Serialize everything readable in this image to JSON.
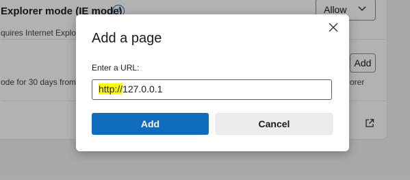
{
  "background": {
    "setting_title": "Explorer mode (IE mode)",
    "setting_subtitle": "quires Internet Explor",
    "allow_select_value": "Allow",
    "row2_text": "ode for 30 days from t",
    "add_button_label": "Add",
    "right_text": "orer",
    "help_icon": "?",
    "icons": [
      "help-icon",
      "chevron-down-icon",
      "open-external-icon"
    ]
  },
  "dialog": {
    "title": "Add a page",
    "url_label": "Enter a URL:",
    "url_value_prefix": "http://",
    "url_value_rest": "127.0.0.1",
    "add_button": "Add",
    "cancel_button": "Cancel",
    "close_icon": "close-icon"
  },
  "colors": {
    "primary": "#0f6cbd",
    "highlight": "#ffff00",
    "link_blue": "#2b66b5"
  }
}
